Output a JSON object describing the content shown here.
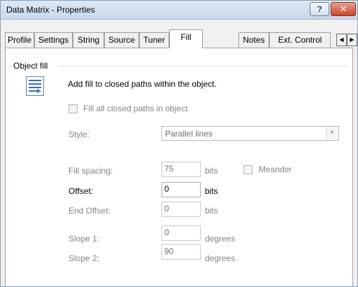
{
  "window": {
    "title": "Data Matrix - Properties",
    "help_glyph": "?",
    "close_glyph": "✕"
  },
  "tabs": [
    {
      "label": "Profile"
    },
    {
      "label": "Settings"
    },
    {
      "label": "String"
    },
    {
      "label": "Source"
    },
    {
      "label": "Tuner"
    },
    {
      "label": "Fill"
    },
    {
      "label": "Notes"
    },
    {
      "label": "Ext. Control"
    }
  ],
  "active_tab": "Fill",
  "tab_scroll": {
    "left": "◀",
    "right": "▶"
  },
  "group": {
    "title": "Object fill",
    "description": "Add fill to closed paths within the object.",
    "fill_all_label": "Fill all closed paths in object",
    "fill_all_checked": false
  },
  "style": {
    "label": "Style:",
    "value": "Parallel lines",
    "arrow": "▼"
  },
  "fields": {
    "fill_spacing": {
      "label": "Fill spacing:",
      "value": "75",
      "unit": "bits"
    },
    "offset": {
      "label": "Offset:",
      "value": "0",
      "unit": "bits"
    },
    "end_offset": {
      "label": "End Offset:",
      "value": "0",
      "unit": "bits"
    },
    "slope1": {
      "label": "Slope 1:",
      "value": "0",
      "unit": "degrees"
    },
    "slope2": {
      "label": "Slope 2:",
      "value": "90",
      "unit": "degrees"
    }
  },
  "meander": {
    "label": "Meander",
    "checked": false
  },
  "colors": {
    "disabled_text": "#838383",
    "panel_bg": "#ffffff",
    "dialog_bg": "#f0f0f0",
    "close_red": "#c7452e"
  }
}
